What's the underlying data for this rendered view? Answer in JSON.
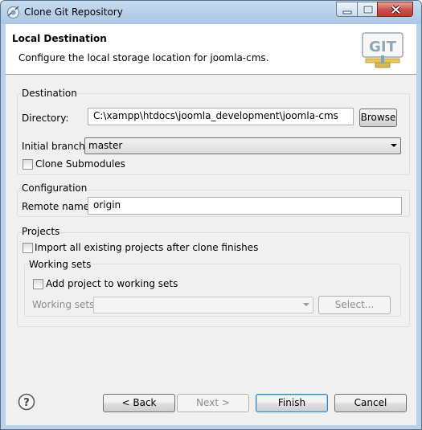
{
  "window": {
    "title": "Clone Git Repository"
  },
  "banner": {
    "title": "Local Destination",
    "description": "Configure the local storage location for joomla-cms.",
    "logo_text": "GIT"
  },
  "destination": {
    "group_label": "Destination",
    "directory_label": "Directory:",
    "directory_value": "C:\\xampp\\htdocs\\joomla_development\\joomla-cms",
    "browse_label": "Browse",
    "branch_label": "Initial branch:",
    "branch_value": "master",
    "submodules_label": "Clone Submodules",
    "submodules_checked": false
  },
  "configuration": {
    "group_label": "Configuration",
    "remote_label": "Remote name:",
    "remote_value": "origin"
  },
  "projects": {
    "group_label": "Projects",
    "import_label": "Import all existing projects after clone finishes",
    "import_checked": false,
    "working_sets": {
      "group_label": "Working sets",
      "add_label": "Add project to working sets",
      "add_checked": false,
      "sets_label": "Working sets:",
      "sets_value": "",
      "select_label": "Select..."
    }
  },
  "footer": {
    "back_label": "< Back",
    "next_label": "Next >",
    "finish_label": "Finish",
    "cancel_label": "Cancel"
  },
  "icons": [
    "app-icon",
    "minimize-icon",
    "maximize-icon",
    "close-icon",
    "git-logo-icon",
    "help-icon",
    "chevron-down-icon"
  ],
  "colors": {
    "title_bar": "#b9d1ea",
    "dialog_bg": "#f0f0f0",
    "close_button": "#c75050",
    "default_button_border": "#3c7fb1"
  }
}
